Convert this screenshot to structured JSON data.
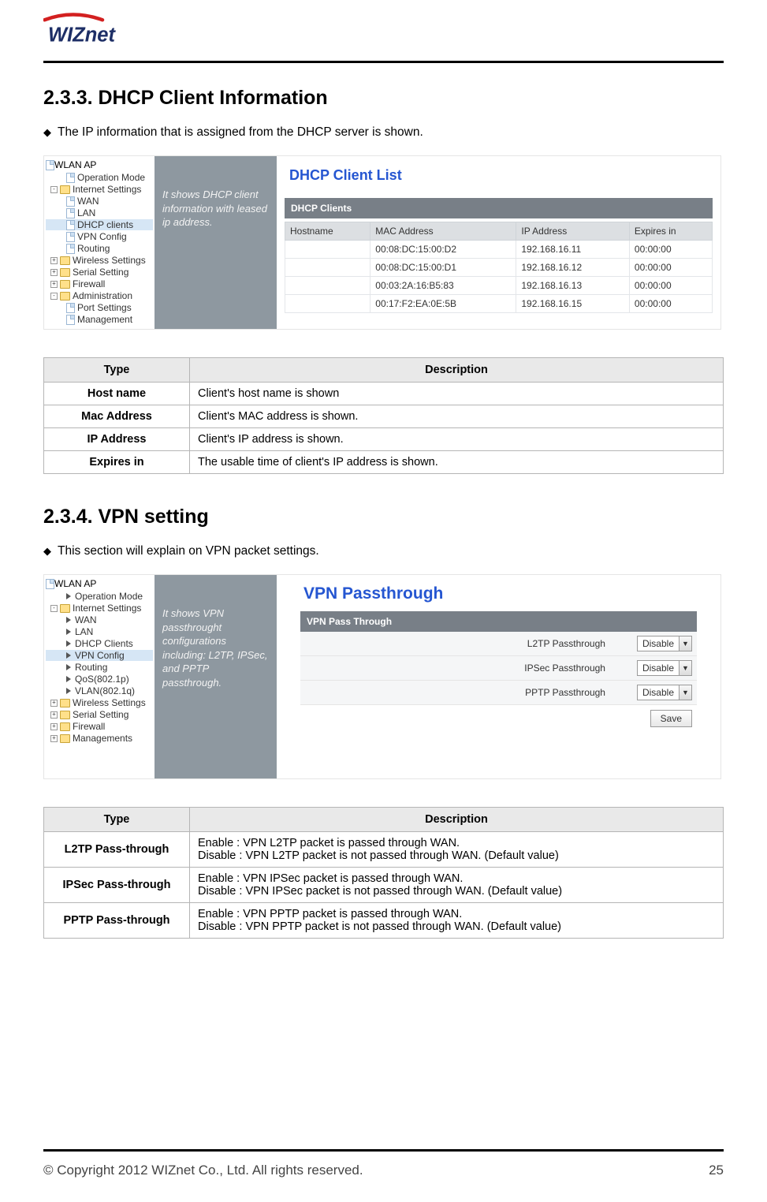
{
  "header": {
    "logo_text": "WIZnet"
  },
  "section233": {
    "heading": "2.3.3.  DHCP  Client  Information",
    "bullet": "The IP information that is assigned from the DHCP server is shown."
  },
  "dhcp_panel": {
    "grey_text": "It shows DHCP client information with leased ip address.",
    "title": "DHCP Client List",
    "header_bar": "DHCP Clients",
    "columns": [
      "Hostname",
      "MAC Address",
      "IP Address",
      "Expires in"
    ],
    "rows": [
      [
        "",
        "00:08:DC:15:00:D2",
        "192.168.16.11",
        "00:00:00"
      ],
      [
        "",
        "00:08:DC:15:00:D1",
        "192.168.16.12",
        "00:00:00"
      ],
      [
        "",
        "00:03:2A:16:B5:83",
        "192.168.16.13",
        "00:00:00"
      ],
      [
        "",
        "00:17:F2:EA:0E:5B",
        "192.168.16.15",
        "00:00:00"
      ]
    ]
  },
  "nav1": {
    "root": "WLAN AP",
    "items": [
      {
        "label": "Operation Mode",
        "icon": "page",
        "level": 2
      },
      {
        "label": "Internet Settings",
        "icon": "folder",
        "level": 1,
        "expander": "-"
      },
      {
        "label": "WAN",
        "icon": "page",
        "level": 2
      },
      {
        "label": "LAN",
        "icon": "page",
        "level": 2
      },
      {
        "label": "DHCP clients",
        "icon": "page",
        "level": 2,
        "selected": true
      },
      {
        "label": "VPN Config",
        "icon": "page",
        "level": 2
      },
      {
        "label": "Routing",
        "icon": "page",
        "level": 2
      },
      {
        "label": "Wireless Settings",
        "icon": "folder",
        "level": 1,
        "expander": "+"
      },
      {
        "label": "Serial Setting",
        "icon": "folder",
        "level": 1,
        "expander": "+"
      },
      {
        "label": "Firewall",
        "icon": "folder",
        "level": 1,
        "expander": "+"
      },
      {
        "label": "Administration",
        "icon": "folder",
        "level": 1,
        "expander": "-"
      },
      {
        "label": "Port Settings",
        "icon": "page",
        "level": 2
      },
      {
        "label": "Management",
        "icon": "page",
        "level": 2
      }
    ]
  },
  "table1": {
    "headers": [
      "Type",
      "Description"
    ],
    "rows": [
      {
        "type": "Host name",
        "desc": [
          "Client's host name is shown"
        ]
      },
      {
        "type": "Mac Address",
        "desc": [
          "Client's MAC address is shown."
        ]
      },
      {
        "type": "IP Address",
        "desc": [
          "Client's IP address is shown."
        ]
      },
      {
        "type": "Expires in",
        "desc": [
          "The usable time of client's IP address is shown."
        ]
      }
    ]
  },
  "section234": {
    "heading": "2.3.4.  VPN  setting",
    "bullet": "This section will explain on VPN packet settings."
  },
  "vpn_panel": {
    "grey_text": "It shows VPN passthrought configurations including: L2TP, IPSec, and PPTP passthrough.",
    "title": "VPN Passthrough",
    "header_bar": "VPN Pass Through",
    "rows": [
      {
        "label": "L2TP Passthrough",
        "value": "Disable"
      },
      {
        "label": "IPSec Passthrough",
        "value": "Disable"
      },
      {
        "label": "PPTP Passthrough",
        "value": "Disable"
      }
    ],
    "save_label": "Save"
  },
  "nav2": {
    "root": "WLAN AP",
    "items": [
      {
        "label": "Operation Mode",
        "icon": "arrow",
        "level": 2
      },
      {
        "label": "Internet Settings",
        "icon": "folder",
        "level": 1,
        "expander": "-"
      },
      {
        "label": "WAN",
        "icon": "arrow",
        "level": 2
      },
      {
        "label": "LAN",
        "icon": "arrow",
        "level": 2
      },
      {
        "label": "DHCP Clients",
        "icon": "arrow",
        "level": 2
      },
      {
        "label": "VPN Config",
        "icon": "arrow",
        "level": 2,
        "selected": true
      },
      {
        "label": "Routing",
        "icon": "arrow",
        "level": 2
      },
      {
        "label": "QoS(802.1p)",
        "icon": "arrow",
        "level": 2
      },
      {
        "label": "VLAN(802.1q)",
        "icon": "arrow",
        "level": 2
      },
      {
        "label": "Wireless Settings",
        "icon": "folder",
        "level": 1,
        "expander": "+"
      },
      {
        "label": "Serial Setting",
        "icon": "folder",
        "level": 1,
        "expander": "+"
      },
      {
        "label": "Firewall",
        "icon": "folder",
        "level": 1,
        "expander": "+"
      },
      {
        "label": "Managements",
        "icon": "folder",
        "level": 1,
        "expander": "+"
      }
    ]
  },
  "table2": {
    "headers": [
      "Type",
      "Description"
    ],
    "rows": [
      {
        "type": "L2TP Pass-through",
        "desc": [
          "Enable : VPN L2TP packet is passed through WAN.",
          "Disable : VPN L2TP packet is not passed through WAN. (Default value)"
        ]
      },
      {
        "type": "IPSec Pass-through",
        "desc": [
          "Enable : VPN IPSec packet is passed through WAN.",
          "Disable : VPN IPSec packet is not passed through WAN. (Default value)"
        ]
      },
      {
        "type": "PPTP Pass-through",
        "desc": [
          "Enable : VPN PPTP packet is passed through WAN.",
          "Disable : VPN PPTP packet is not passed through WAN. (Default value)"
        ]
      }
    ]
  },
  "footer": {
    "copyright": "© Copyright 2012 WIZnet Co., Ltd. All rights reserved.",
    "page": "25"
  }
}
